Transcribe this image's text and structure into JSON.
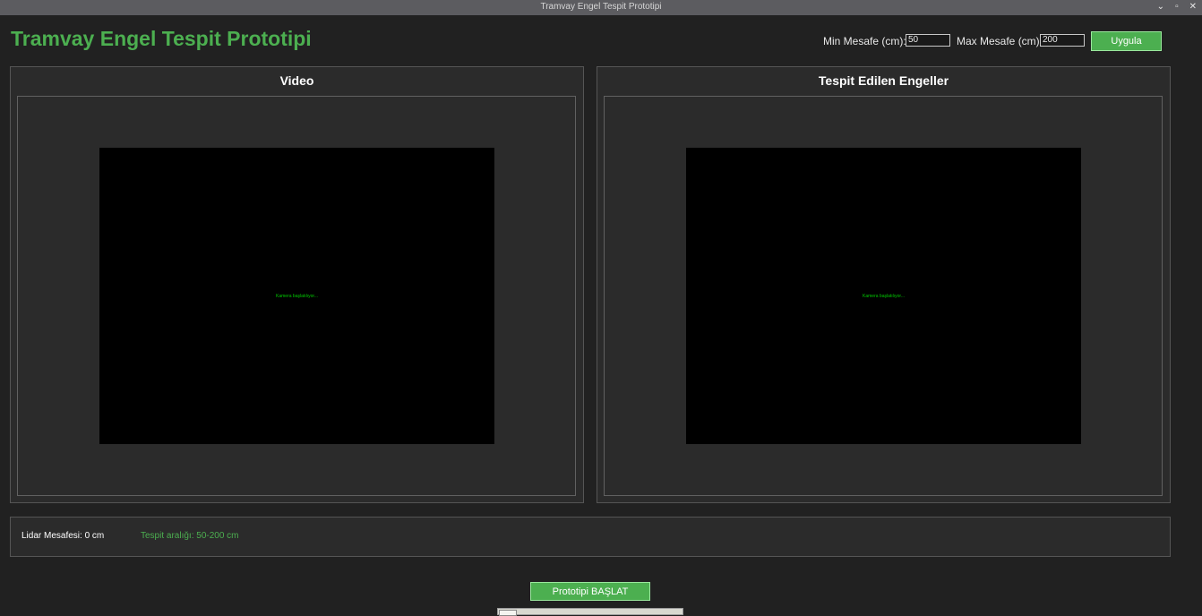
{
  "window": {
    "title": "Tramvay Engel Tespit Prototipi",
    "controls": [
      "⌄",
      "▫",
      "✕"
    ]
  },
  "header": {
    "title": "Tramvay Engel Tespit Prototipi",
    "min_label": "Min Mesafe (cm):",
    "min_value": "50",
    "max_label": "Max Mesafe (cm):",
    "max_value": "200",
    "apply_label": "Uygula"
  },
  "panels": {
    "video": {
      "title": "Video",
      "placeholder": "Kamera başlatılıyor..."
    },
    "detected": {
      "title": "Tespit Edilen Engeller",
      "placeholder": "Kamera başlatılıyor..."
    }
  },
  "status": {
    "lidar": "Lidar Mesafesi: 0 cm",
    "range": "Tespit aralığı: 50-200 cm"
  },
  "actions": {
    "start_label": "Prototipi BAŞLAT"
  },
  "colors": {
    "accent": "#4caf50",
    "background": "#212121",
    "panel": "#2b2b2b"
  }
}
